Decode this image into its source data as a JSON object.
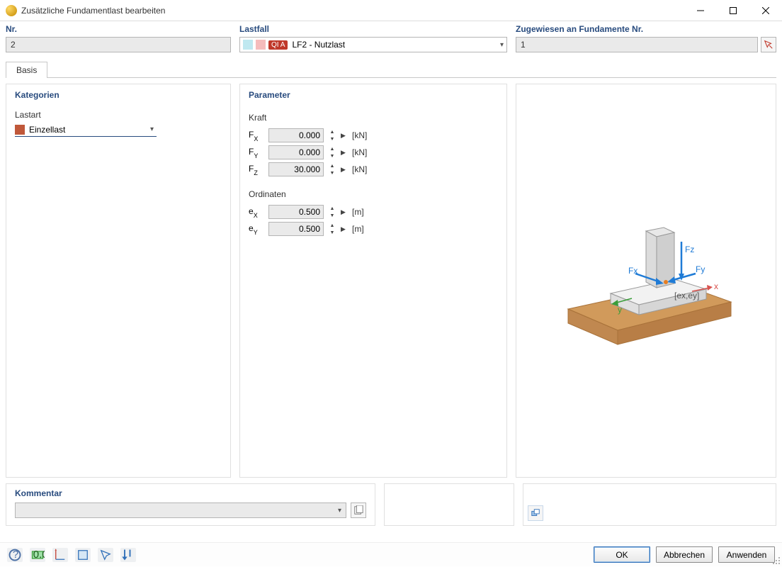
{
  "window": {
    "title": "Zusätzliche Fundamentlast bearbeiten"
  },
  "top": {
    "nr": {
      "label": "Nr.",
      "value": "2"
    },
    "lastfall": {
      "label": "Lastfall",
      "badge": "QI A",
      "text": "LF2 - Nutzlast"
    },
    "zugewiesen": {
      "label": "Zugewiesen an Fundamente Nr.",
      "value": "1"
    }
  },
  "tabs": {
    "basis": "Basis"
  },
  "kategorien": {
    "title": "Kategorien",
    "lastart_label": "Lastart",
    "lastart_value": "Einzellast"
  },
  "parameter": {
    "title": "Parameter",
    "kraft_label": "Kraft",
    "fx": {
      "sym": "F",
      "sub": "X",
      "value": "0.000",
      "unit": "[kN]"
    },
    "fy": {
      "sym": "F",
      "sub": "Y",
      "value": "0.000",
      "unit": "[kN]"
    },
    "fz": {
      "sym": "F",
      "sub": "Z",
      "value": "30.000",
      "unit": "[kN]"
    },
    "ordinaten_label": "Ordinaten",
    "ex": {
      "sym": "e",
      "sub": "X",
      "value": "0.500",
      "unit": "[m]"
    },
    "ey": {
      "sym": "e",
      "sub": "Y",
      "value": "0.500",
      "unit": "[m]"
    }
  },
  "preview_labels": {
    "fz": "Fz",
    "fy": "Fy",
    "fx": "Fx",
    "x": "x",
    "y": "y",
    "exey": "[ex,ey]"
  },
  "kommentar": {
    "title": "Kommentar",
    "value": ""
  },
  "buttons": {
    "ok": "OK",
    "abbrechen": "Abbrechen",
    "anwenden": "Anwenden"
  }
}
